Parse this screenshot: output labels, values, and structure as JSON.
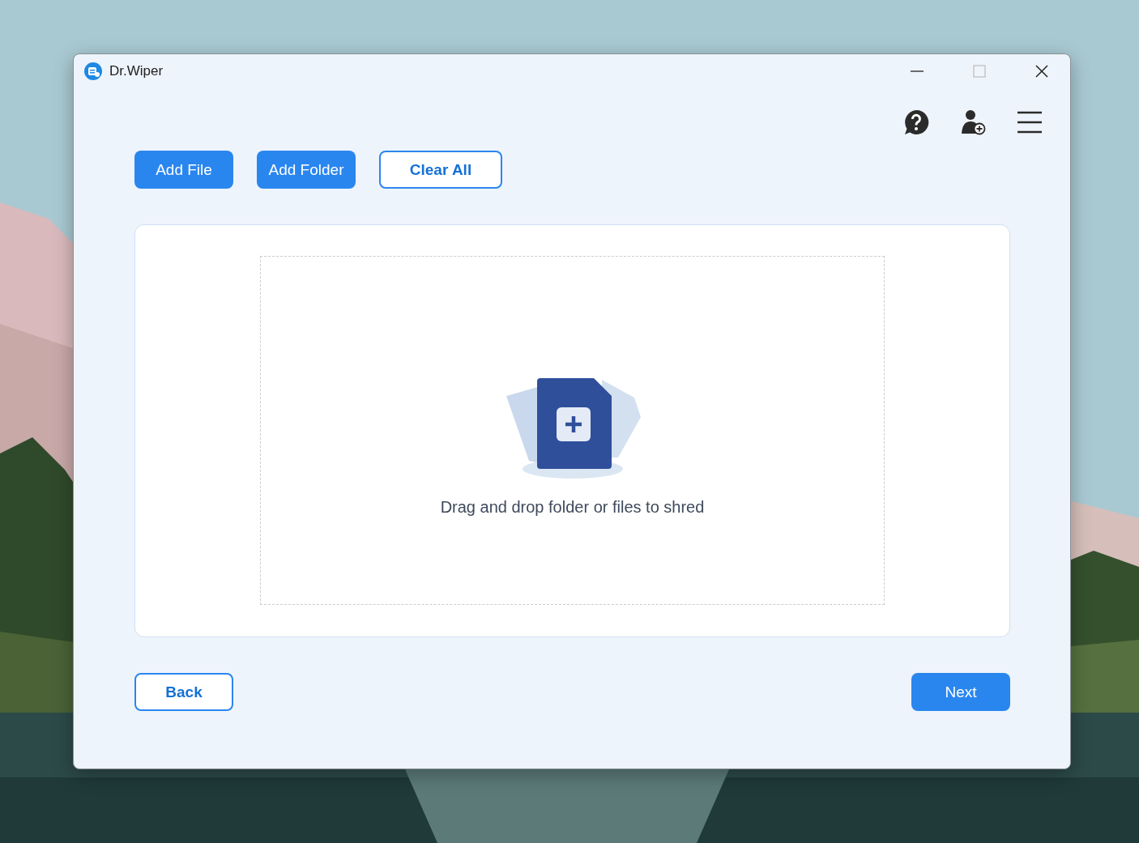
{
  "window": {
    "title": "Dr.Wiper"
  },
  "actions": [
    {
      "label": "Add File",
      "kind": "primary"
    },
    {
      "label": "Add Folder",
      "kind": "primary"
    },
    {
      "label": "Clear All",
      "kind": "outline"
    }
  ],
  "drop_zone": {
    "message": "Drag and drop folder or files to shred"
  },
  "footer": [
    {
      "label": "Back",
      "kind": "outline"
    },
    {
      "label": "Next",
      "kind": "primary"
    }
  ]
}
